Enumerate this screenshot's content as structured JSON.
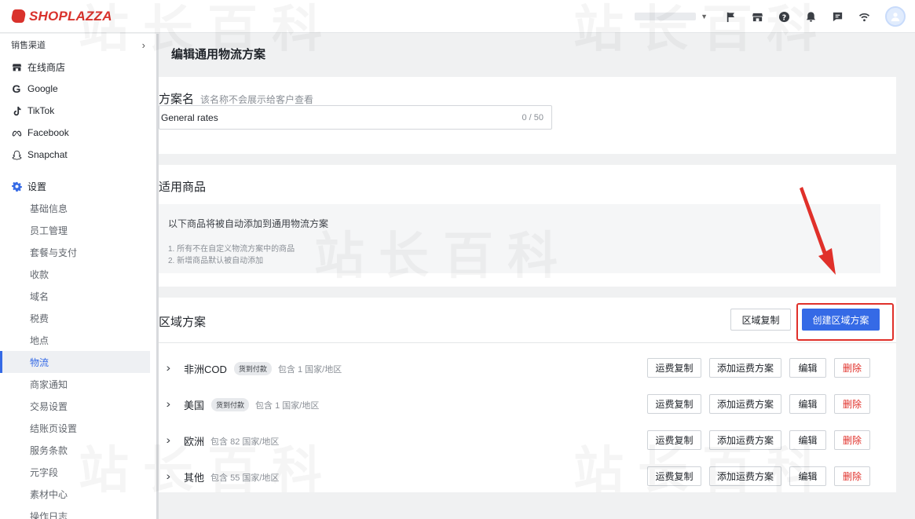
{
  "brand": {
    "name": "SHOPLAZZA"
  },
  "topbar": {
    "icons": [
      "flag-icon",
      "store-icon",
      "help-icon",
      "bell-icon",
      "message-icon",
      "wifi-icon",
      "avatar"
    ]
  },
  "sidebar": {
    "section_label": "销售渠道",
    "channels": [
      {
        "label": "在线商店",
        "icon": "store-icon"
      },
      {
        "label": "Google",
        "icon": "google-icon"
      },
      {
        "label": "TikTok",
        "icon": "tiktok-icon"
      },
      {
        "label": "Facebook",
        "icon": "meta-icon"
      },
      {
        "label": "Snapchat",
        "icon": "snapchat-icon"
      }
    ],
    "settings_label": "设置",
    "settings_items": [
      "基础信息",
      "员工管理",
      "套餐与支付",
      "收款",
      "域名",
      "税费",
      "地点",
      "物流",
      "商家通知",
      "交易设置",
      "结账页设置",
      "服务条款",
      "元字段",
      "素材中心",
      "操作日志"
    ],
    "active_item": "物流"
  },
  "page": {
    "title": "编辑通用物流方案"
  },
  "name_card": {
    "label": "方案名",
    "hint": "该名称不会展示给客户查看",
    "value": "General rates",
    "counter": "0 / 50"
  },
  "products_card": {
    "title": "适用商品",
    "info_title": "以下商品将被自动添加到通用物流方案",
    "lines": [
      "1. 所有不在自定义物流方案中的商品",
      "2. 新增商品默认被自动添加"
    ]
  },
  "region_card": {
    "title": "区域方案",
    "copy_button": "区域复制",
    "create_button": "创建区域方案",
    "row_buttons": {
      "copy": "运费复制",
      "add": "添加运费方案",
      "edit": "编辑",
      "delete": "删除"
    },
    "regions": [
      {
        "name": "非洲COD",
        "tag": "货到付款",
        "count": "包含 1 国家/地区"
      },
      {
        "name": "美国",
        "tag": "货到付款",
        "count": "包含 1 国家/地区"
      },
      {
        "name": "欧洲",
        "tag": "",
        "count": "包含 82 国家/地区"
      },
      {
        "name": "其他",
        "tag": "",
        "count": "包含 55 国家/地区"
      }
    ]
  },
  "colors": {
    "primary": "#356ae6",
    "danger": "#e0302a",
    "brand": "#d9322c"
  }
}
